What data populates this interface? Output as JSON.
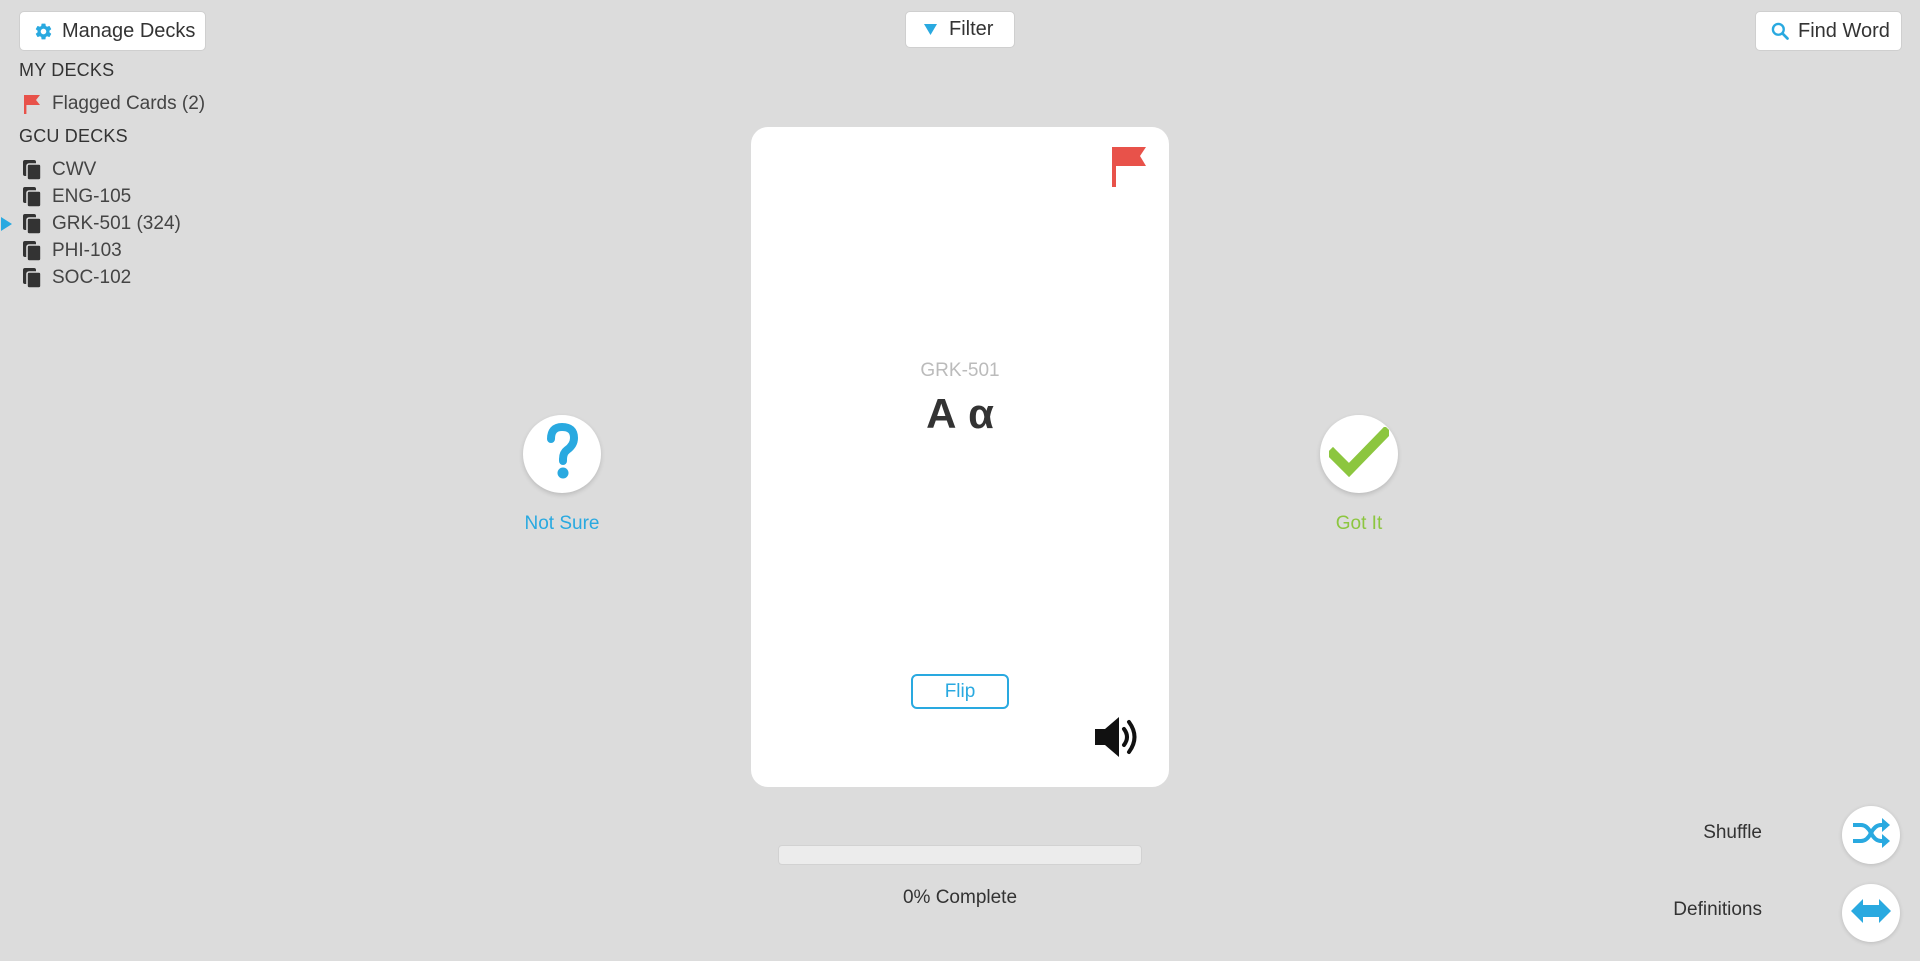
{
  "toolbar": {
    "manage_decks_label": "Manage Decks",
    "filter_label": "Filter",
    "find_word_label": "Find Word"
  },
  "sidebar": {
    "my_decks_title": "MY DECKS",
    "flagged_cards_label": "Flagged Cards (2)",
    "gcu_decks_title": "GCU DECKS",
    "decks": [
      {
        "label": "CWV",
        "active": false
      },
      {
        "label": "ENG-105",
        "active": false
      },
      {
        "label": "GRK-501 (324)",
        "active": true
      },
      {
        "label": "PHI-103",
        "active": false
      },
      {
        "label": "SOC-102",
        "active": false
      }
    ]
  },
  "card": {
    "deck_name": "GRK-501",
    "word": "Α α",
    "flip_label": "Flip",
    "flagged": true
  },
  "actions": {
    "not_sure_label": "Not Sure",
    "got_it_label": "Got It",
    "shuffle_label": "Shuffle",
    "definitions_label": "Definitions"
  },
  "progress": {
    "percent": 0,
    "text": "0% Complete"
  },
  "colors": {
    "accent_blue": "#29a9e0",
    "success_green": "#8cc63f",
    "flag_red": "#e8524a",
    "background": "#dcdcdc"
  },
  "icons": {
    "manage": "gear-icon",
    "filter": "caret-down-icon",
    "find": "search-icon",
    "flag": "flag-icon",
    "deck": "deck-stack-icon",
    "not_sure": "question-mark-icon",
    "got_it": "checkmark-icon",
    "audio": "speaker-icon",
    "shuffle": "shuffle-icon",
    "definitions": "swap-arrows-icon"
  }
}
